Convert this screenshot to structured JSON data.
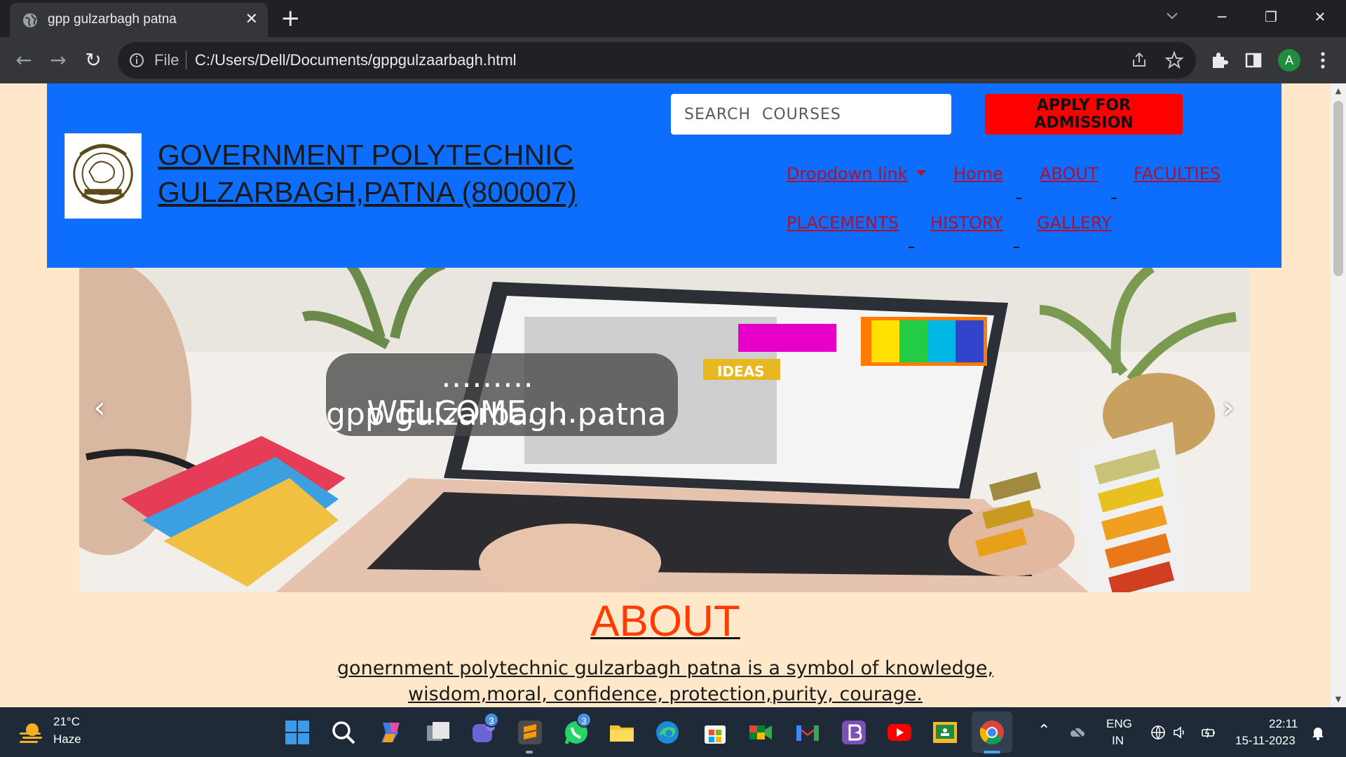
{
  "browser": {
    "tab_title": "gpp gulzarbagh patna",
    "tab_close": "✕",
    "new_tab": "+",
    "url_scheme": "File",
    "url": "C:/Users/Dell/Documents/gppgulzaarbagh.html",
    "profile_initial": "A",
    "window_controls": [
      "─",
      "❐",
      "✕"
    ],
    "nav": {
      "back": "←",
      "forward": "→",
      "reload": "↻"
    }
  },
  "site": {
    "title_line1": "GOVERNMENT POLYTECHNIC",
    "title_line2": "GULZARBAGH,PATNA (800007)",
    "search_placeholder": "SEARCH  COURSES",
    "apply_button": "APPLY FOR ADMISSION",
    "nav": {
      "dropdown": "Dropdown link",
      "home": "Home",
      "about": "ABOUT",
      "faculties": "FACULTIES",
      "placements": "PLACEMENTS",
      "history": "HISTORY",
      "gallery": "GALLERY"
    },
    "carousel": {
      "caption_line1": "………WELCOME……..",
      "caption_line2": "gpp gulzarbagh patna",
      "prev": "‹",
      "next": "›",
      "banner_text": "IDEAS"
    },
    "about": {
      "heading": "ABOUT",
      "line1": "gonernment polytechnic gulzarbagh patna is a symbol of knowledge,",
      "line2": "wisdom,moral, confidence, protection,purity, courage."
    }
  },
  "taskbar": {
    "weather_temp": "21°C",
    "weather_cond": "Haze",
    "badges": {
      "teams": "3",
      "whatsapp": "3"
    },
    "language_line1": "ENG",
    "language_line2": "IN",
    "time": "22:11",
    "date": "15-11-2023",
    "colors": {
      "accent": "#0d6efd",
      "apply": "#ff0000",
      "about": "#ff3c00"
    }
  }
}
